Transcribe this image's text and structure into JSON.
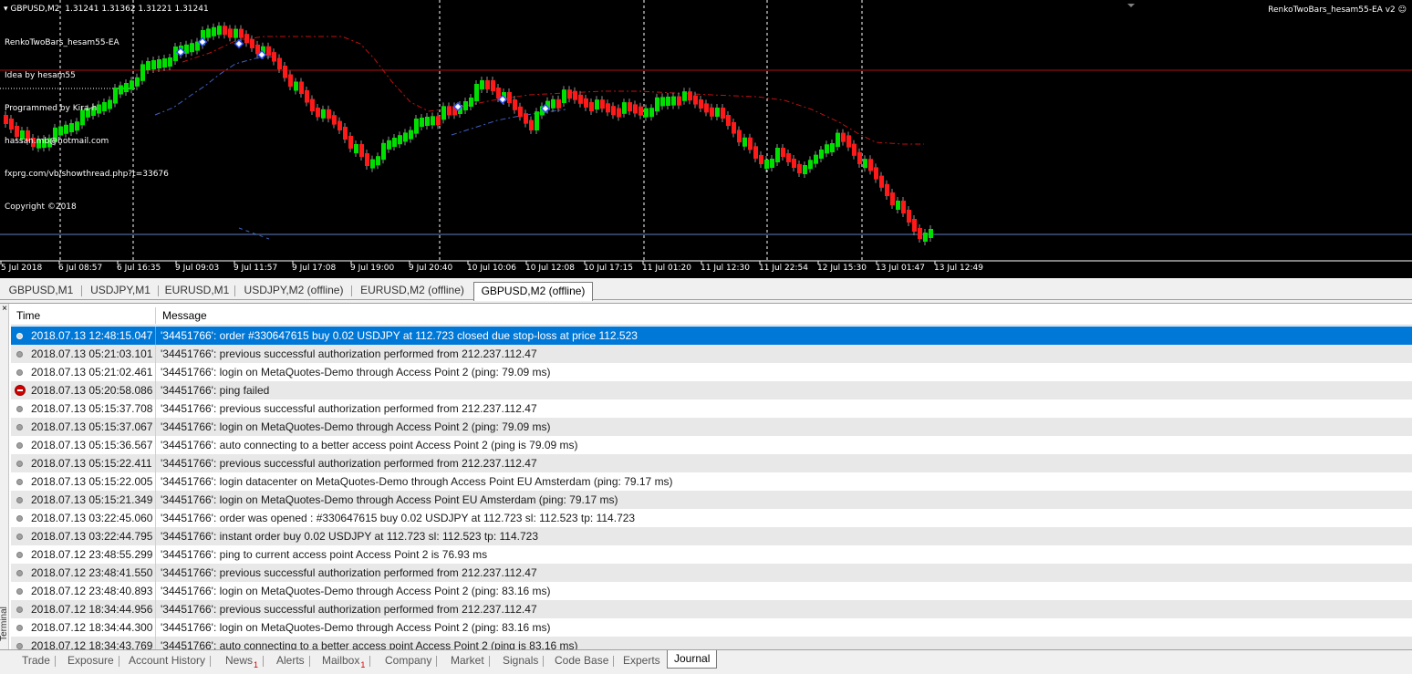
{
  "chart": {
    "header": "▾ GBPUSD,M2  1.31241 1.31362 1.31221 1.31241",
    "ea_info": [
      "RenkoTwoBars_hesam55-EA",
      "Idea by hesam55",
      "Programmed by Kira-h",
      "hassan.mb@hotmail.com",
      "fxprg.com/vb/showthread.php?t=33676",
      "Copyright ©2018"
    ],
    "ea_name": "RenkoTwoBars_hesam55-EA v2 ☺",
    "x_ticks": [
      "5 Jul 2018",
      "6 Jul 08:57",
      "6 Jul 16:35",
      "9 Jul 09:03",
      "9 Jul 11:57",
      "9 Jul 17:08",
      "9 Jul 19:00",
      "9 Jul 20:40",
      "10 Jul 10:06",
      "10 Jul 12:08",
      "10 Jul 17:15",
      "11 Jul 01:20",
      "11 Jul 12:30",
      "11 Jul 22:54",
      "12 Jul 15:30",
      "13 Jul 01:47",
      "13 Jul 12:49"
    ],
    "colors": {
      "background": "#000000",
      "bull": "#00e000",
      "bear": "#ff1a1a",
      "level_line": "#b01010",
      "support_line": "#6080c0",
      "signal": "#3050ff"
    }
  },
  "chart_tabs": [
    {
      "label": "GBPUSD,M1",
      "active": false
    },
    {
      "label": "USDJPY,M1",
      "active": false
    },
    {
      "label": "EURUSD,M1",
      "active": false
    },
    {
      "label": "USDJPY,M2 (offline)",
      "active": false
    },
    {
      "label": "EURUSD,M2 (offline)",
      "active": false
    },
    {
      "label": "GBPUSD,M2 (offline)",
      "active": true
    }
  ],
  "terminal": {
    "close_label": "×",
    "side_label": "Terminal",
    "columns": {
      "time": "Time",
      "message": "Message"
    },
    "rows": [
      {
        "time": "2018.07.13 12:48:15.047",
        "message": "'34451766': order #330647615 buy 0.02 USDJPY at 112.723 closed due stop-loss at price 112.523",
        "level": "info",
        "selected": true
      },
      {
        "time": "2018.07.13 05:21:03.101",
        "message": "'34451766': previous successful authorization performed from 212.237.112.47",
        "level": "info"
      },
      {
        "time": "2018.07.13 05:21:02.461",
        "message": "'34451766': login on MetaQuotes-Demo through Access Point 2 (ping: 79.09 ms)",
        "level": "info"
      },
      {
        "time": "2018.07.13 05:20:58.086",
        "message": "'34451766': ping failed",
        "level": "error"
      },
      {
        "time": "2018.07.13 05:15:37.708",
        "message": "'34451766': previous successful authorization performed from 212.237.112.47",
        "level": "info"
      },
      {
        "time": "2018.07.13 05:15:37.067",
        "message": "'34451766': login on MetaQuotes-Demo through Access Point 2 (ping: 79.09 ms)",
        "level": "info"
      },
      {
        "time": "2018.07.13 05:15:36.567",
        "message": "'34451766': auto connecting to a better access point Access Point 2 (ping is 79.09 ms)",
        "level": "info"
      },
      {
        "time": "2018.07.13 05:15:22.411",
        "message": "'34451766': previous successful authorization performed from 212.237.112.47",
        "level": "info"
      },
      {
        "time": "2018.07.13 05:15:22.005",
        "message": "'34451766': login datacenter on MetaQuotes-Demo through Access Point EU Amsterdam (ping: 79.17 ms)",
        "level": "info"
      },
      {
        "time": "2018.07.13 05:15:21.349",
        "message": "'34451766': login on MetaQuotes-Demo through Access Point EU Amsterdam (ping: 79.17 ms)",
        "level": "info"
      },
      {
        "time": "2018.07.13 03:22:45.060",
        "message": "'34451766': order was opened : #330647615 buy 0.02 USDJPY at 112.723 sl: 112.523 tp: 114.723",
        "level": "info"
      },
      {
        "time": "2018.07.13 03:22:44.795",
        "message": "'34451766': instant order buy 0.02 USDJPY at 112.723 sl: 112.523 tp: 114.723",
        "level": "info"
      },
      {
        "time": "2018.07.12 23:48:55.299",
        "message": "'34451766': ping to current access point Access Point 2 is 76.93 ms",
        "level": "info"
      },
      {
        "time": "2018.07.12 23:48:41.550",
        "message": "'34451766': previous successful authorization performed from 212.237.112.47",
        "level": "info"
      },
      {
        "time": "2018.07.12 23:48:40.893",
        "message": "'34451766': login on MetaQuotes-Demo through Access Point 2 (ping: 83.16 ms)",
        "level": "info"
      },
      {
        "time": "2018.07.12 18:34:44.956",
        "message": "'34451766': previous successful authorization performed from 212.237.112.47",
        "level": "info"
      },
      {
        "time": "2018.07.12 18:34:44.300",
        "message": "'34451766': login on MetaQuotes-Demo through Access Point 2 (ping: 83.16 ms)",
        "level": "info"
      },
      {
        "time": "2018.07.12 18:34:43.769",
        "message": "'34451766': auto connecting to a better access point Access Point 2 (ping is 83.16 ms)",
        "level": "info"
      }
    ]
  },
  "bottom_tabs": [
    {
      "label": "Trade",
      "badge": ""
    },
    {
      "label": "Exposure",
      "badge": ""
    },
    {
      "label": "Account History",
      "badge": ""
    },
    {
      "label": "News",
      "badge": "1"
    },
    {
      "label": "Alerts",
      "badge": ""
    },
    {
      "label": "Mailbox",
      "badge": "1"
    },
    {
      "label": "Company",
      "badge": ""
    },
    {
      "label": "Market",
      "badge": ""
    },
    {
      "label": "Signals",
      "badge": ""
    },
    {
      "label": "Code Base",
      "badge": ""
    },
    {
      "label": "Experts",
      "badge": ""
    },
    {
      "label": "Journal",
      "badge": "",
      "active": true
    }
  ]
}
